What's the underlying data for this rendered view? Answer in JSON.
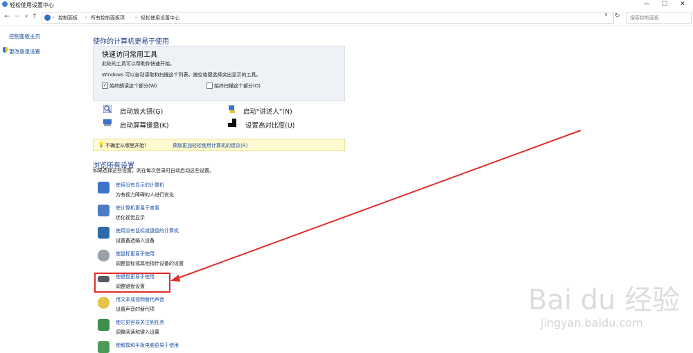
{
  "window": {
    "title": "轻松使用设置中心",
    "controls": [
      "—",
      "☐",
      "✕"
    ]
  },
  "nav": {
    "back": "←",
    "forward": "→",
    "dropdown": "∨",
    "up": "↑"
  },
  "address": {
    "crumbs": [
      "控制面板",
      "所有控制面板项",
      "轻松使用设置中心"
    ],
    "sep": "›",
    "dropdown": "∨",
    "refresh": "↻"
  },
  "search": {
    "placeholder": "搜索控制面板"
  },
  "sidebar": {
    "items": [
      {
        "label": "控制面板主页"
      },
      {
        "label": "更改登录设置"
      }
    ]
  },
  "main": {
    "heading": "使你的计算机更易于使用",
    "quick_access": {
      "title": "快速访问常用工具",
      "line1": "此处的工具可以帮助你快速开始。",
      "line2": "Windows 可以自动读取和扫描这个列表。按空格键选择突出显示的工具。",
      "checkbox1": {
        "label": "始终朗读这个部分(W)",
        "checked": true
      },
      "checkbox2": {
        "label": "始终扫描这个部分(O)",
        "checked": false
      }
    },
    "tools": [
      {
        "label": "启动放大镜(G)",
        "icon": "magnifier-icon"
      },
      {
        "label": "启动\"讲述人\"(N)",
        "icon": "narrator-icon"
      },
      {
        "label": "启动屏幕键盘(K)",
        "icon": "keyboard-icon"
      },
      {
        "label": "设置高对比度(U)",
        "icon": "contrast-icon"
      }
    ],
    "hint": {
      "question": "不确定从哪里开始?",
      "link": "获取更加轻松使用计算机的建议(R)"
    },
    "browse": {
      "heading": "浏览所有设置",
      "subtitle": "如果选择这些设置，则在每次登录时自动启动这些设置。",
      "items": [
        {
          "title": "使用没有显示的计算机",
          "desc": "为有视力障碍的人进行优化",
          "color": "#3b74c9"
        },
        {
          "title": "使计算机更易于查看",
          "desc": "优化视觉显示",
          "color": "#4a7bc4"
        },
        {
          "title": "使用没有鼠标或键盘的计算机",
          "desc": "设置备选输入设备",
          "color": "#2f6aa8"
        },
        {
          "title": "使鼠标更易于使用",
          "desc": "调整鼠标或其他指针设备的设置",
          "color": "#9aa0a8"
        },
        {
          "title": "使键盘更易于使用",
          "desc": "调整键盘设置",
          "color": "#555b63"
        },
        {
          "title": "用文本或视频替代声音",
          "desc": "设置声音的替代项",
          "color": "#e6c44a"
        },
        {
          "title": "使它更容易关注到任务",
          "desc": "调整阅读和键入设置",
          "color": "#3d8f4b"
        },
        {
          "title": "使触摸和平板电脑更易于使用",
          "desc": "",
          "color": "#4c9a55"
        }
      ]
    }
  },
  "watermark": {
    "text": "Bai du 经验",
    "url": "jingyan.baidu.com"
  },
  "annotation": {
    "color": "#e22c2c"
  }
}
